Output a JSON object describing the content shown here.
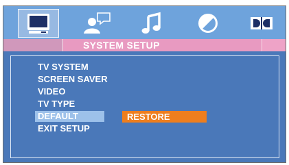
{
  "header": {
    "tabs": [
      {
        "icon": "tv-icon",
        "active": true
      },
      {
        "icon": "person-speech-icon",
        "active": false
      },
      {
        "icon": "music-note-icon",
        "active": false
      },
      {
        "icon": "circle-slash-icon",
        "active": false
      },
      {
        "icon": "dolby-icon",
        "active": false
      }
    ],
    "title": "SYSTEM SETUP"
  },
  "menu": {
    "items": [
      {
        "label": "TV SYSTEM"
      },
      {
        "label": "SCREEN SAVER"
      },
      {
        "label": "VIDEO"
      },
      {
        "label": "TV TYPE"
      },
      {
        "label": "DEFAULT",
        "selected": true
      },
      {
        "label": "EXIT SETUP"
      }
    ],
    "option_value": "RESTORE"
  },
  "colors": {
    "background": "#4a78b9",
    "icon_bar": "#6ea3dc",
    "title_bar": "#e89ac1",
    "selected_item": "#9dc1ea",
    "option_highlight": "#ee7e1e"
  }
}
